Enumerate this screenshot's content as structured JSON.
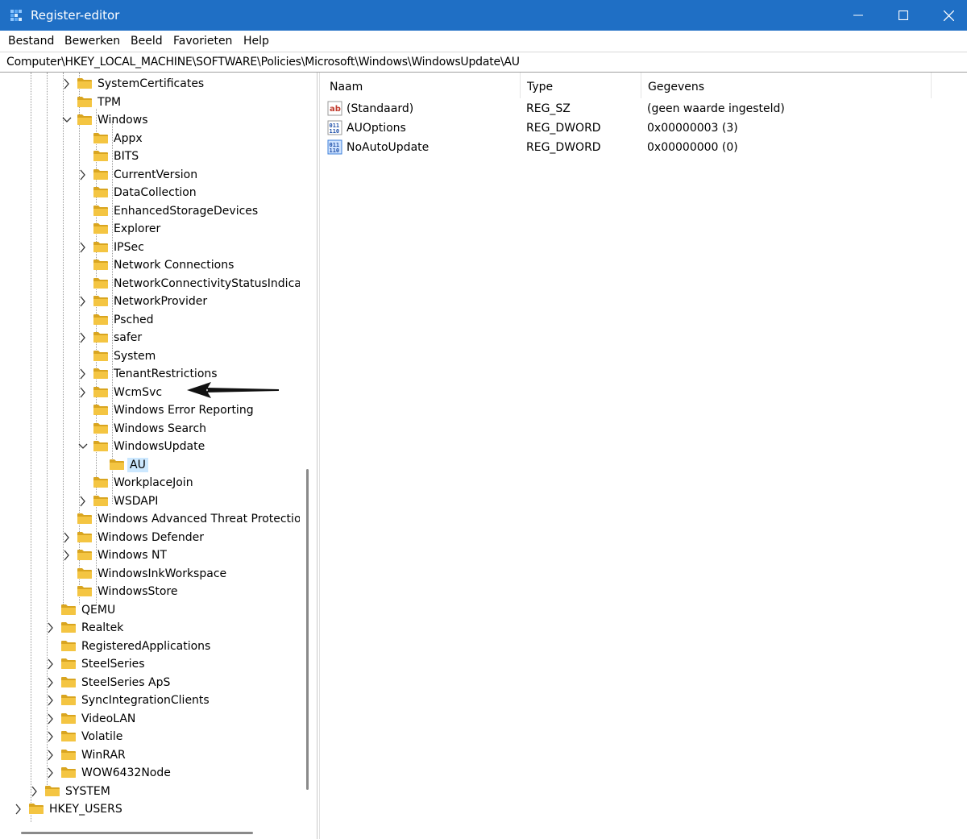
{
  "window": {
    "title": "Register-editor",
    "controls": {
      "minimize": "—",
      "maximize": "☐",
      "close": "✕"
    }
  },
  "menu": [
    "Bestand",
    "Bewerken",
    "Beeld",
    "Favorieten",
    "Help"
  ],
  "address": "Computer\\HKEY_LOCAL_MACHINE\\SOFTWARE\\Policies\\Microsoft\\Windows\\WindowsUpdate\\AU",
  "tree": [
    {
      "label": "SystemCertificates",
      "depth": 2,
      "expander": "collapsed"
    },
    {
      "label": "TPM",
      "depth": 2,
      "expander": "none"
    },
    {
      "label": "Windows",
      "depth": 2,
      "expander": "expanded"
    },
    {
      "label": "Appx",
      "depth": 3,
      "expander": "none"
    },
    {
      "label": "BITS",
      "depth": 3,
      "expander": "none"
    },
    {
      "label": "CurrentVersion",
      "depth": 3,
      "expander": "collapsed"
    },
    {
      "label": "DataCollection",
      "depth": 3,
      "expander": "none"
    },
    {
      "label": "EnhancedStorageDevices",
      "depth": 3,
      "expander": "none"
    },
    {
      "label": "Explorer",
      "depth": 3,
      "expander": "none"
    },
    {
      "label": "IPSec",
      "depth": 3,
      "expander": "collapsed"
    },
    {
      "label": "Network Connections",
      "depth": 3,
      "expander": "none"
    },
    {
      "label": "NetworkConnectivityStatusIndicator",
      "depth": 3,
      "expander": "none"
    },
    {
      "label": "NetworkProvider",
      "depth": 3,
      "expander": "collapsed"
    },
    {
      "label": "Psched",
      "depth": 3,
      "expander": "none"
    },
    {
      "label": "safer",
      "depth": 3,
      "expander": "collapsed"
    },
    {
      "label": "System",
      "depth": 3,
      "expander": "none"
    },
    {
      "label": "TenantRestrictions",
      "depth": 3,
      "expander": "collapsed"
    },
    {
      "label": "WcmSvc",
      "depth": 3,
      "expander": "collapsed"
    },
    {
      "label": "Windows Error Reporting",
      "depth": 3,
      "expander": "none"
    },
    {
      "label": "Windows Search",
      "depth": 3,
      "expander": "none"
    },
    {
      "label": "WindowsUpdate",
      "depth": 3,
      "expander": "expanded"
    },
    {
      "label": "AU",
      "depth": 4,
      "expander": "none",
      "selected": true
    },
    {
      "label": "WorkplaceJoin",
      "depth": 3,
      "expander": "none"
    },
    {
      "label": "WSDAPI",
      "depth": 3,
      "expander": "collapsed"
    },
    {
      "label": "Windows Advanced Threat Protection",
      "depth": 2,
      "expander": "none"
    },
    {
      "label": "Windows Defender",
      "depth": 2,
      "expander": "collapsed"
    },
    {
      "label": "Windows NT",
      "depth": 2,
      "expander": "collapsed"
    },
    {
      "label": "WindowsInkWorkspace",
      "depth": 2,
      "expander": "none"
    },
    {
      "label": "WindowsStore",
      "depth": 2,
      "expander": "none"
    },
    {
      "label": "QEMU",
      "depth": 1,
      "expander": "none"
    },
    {
      "label": "Realtek",
      "depth": 1,
      "expander": "collapsed"
    },
    {
      "label": "RegisteredApplications",
      "depth": 1,
      "expander": "none"
    },
    {
      "label": "SteelSeries",
      "depth": 1,
      "expander": "collapsed"
    },
    {
      "label": "SteelSeries ApS",
      "depth": 1,
      "expander": "collapsed"
    },
    {
      "label": "SyncIntegrationClients",
      "depth": 1,
      "expander": "collapsed"
    },
    {
      "label": "VideoLAN",
      "depth": 1,
      "expander": "collapsed"
    },
    {
      "label": "Volatile",
      "depth": 1,
      "expander": "collapsed"
    },
    {
      "label": "WinRAR",
      "depth": 1,
      "expander": "collapsed"
    },
    {
      "label": "WOW6432Node",
      "depth": 1,
      "expander": "collapsed"
    },
    {
      "label": "SYSTEM",
      "depth": 0,
      "expander": "collapsed"
    },
    {
      "label": "HKEY_USERS",
      "depth": -1,
      "expander": "collapsed"
    }
  ],
  "values": {
    "columns": [
      "Naam",
      "Type",
      "Gegevens"
    ],
    "rows": [
      {
        "name": "(Standaard)",
        "type": "REG_SZ",
        "data": "(geen waarde ingesteld)",
        "icon": "string-value-icon"
      },
      {
        "name": "AUOptions",
        "type": "REG_DWORD",
        "data": "0x00000003 (3)",
        "icon": "dword-value-icon"
      },
      {
        "name": "NoAutoUpdate",
        "type": "REG_DWORD",
        "data": "0x00000000 (0)",
        "icon": "dword-value-icon",
        "highlight": true
      }
    ]
  },
  "colors": {
    "titlebar": "#1f6fc5",
    "folder": "#f4c542",
    "folder_dark": "#d9a520",
    "selection": "#cce8ff"
  }
}
